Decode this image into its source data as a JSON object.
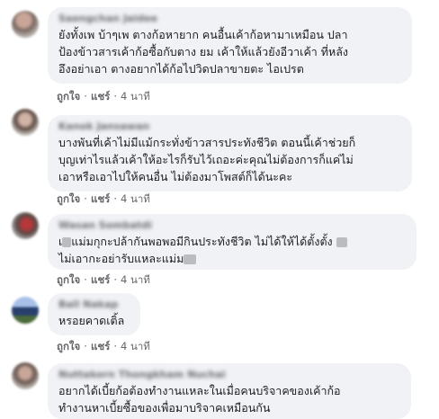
{
  "comments": [
    {
      "author": "Saengchan Jaidee",
      "text": "ยังทั้งเพ บ้าๆเพ ตางก้อหายาก คนอื้นเค้าก้อหามาเหมือน ปลา\nป้องข้าวสารเค้าก้อซื้อกับตาง ยม เค้าให้แล้วยังอีวาเค้า ที่หลัง\nอึงอย่าเอา ตางอยากได้ก้อไปวิดปลาขายตะ ไอเปรต",
      "like": "ถูกใจ",
      "reply": "แชร์",
      "time": "4 นาที"
    },
    {
      "author": "Kanok Jansawan",
      "text": "บางพันที่เค้าไม่มีแม้กระทั่งข้าวสารประทังชีวิต ตอนนี้เค้าช่วยก็\nบุญเท่าไรแล้วเค้าให้อะไรก็รับไว้เถอะค่ะคุณไม่ต้องการก็แค่ไม่\nเอาหรือเอาไปให้คนอื่น ไม่ต้องมาโพสต์ก็ได้นะคะ",
      "like": "ถูกใจ",
      "reply": "แชร์",
      "time": "4 นาที"
    },
    {
      "author": "Wasan Sombatdi",
      "text_prefix": "เ",
      "text_middle": "แม่มกุกะปล้ากันพอพอมีกินประทังชีวิต ไม่ได้ให้ได้ตั้งตั้ง",
      "text_line2_start": "ไม่เอากะอย่ารับแหละแม่ม",
      "like": "ถูกใจ",
      "reply": "แชร์",
      "time": "4 นาที"
    },
    {
      "author": "Ball Nakap",
      "text": "หรอยคาดเติ้ล",
      "like": "ถูกใจ",
      "reply": "แชร์",
      "time": "4 นาที"
    },
    {
      "author": "Nuttakorn Thongkham Nuchai",
      "text": "อยากได้เบี้ยก้อต้องทำงานแหละในเมื่อคนบริจาคของเค้าก้อ\nทำงานหาเบี้ยซื้อของเพื่อมาบริจาคเหมือนกัน"
    }
  ],
  "colors": {
    "bubble": "#f0f2f5",
    "action_text": "#65676b",
    "text": "#1c1e21"
  }
}
